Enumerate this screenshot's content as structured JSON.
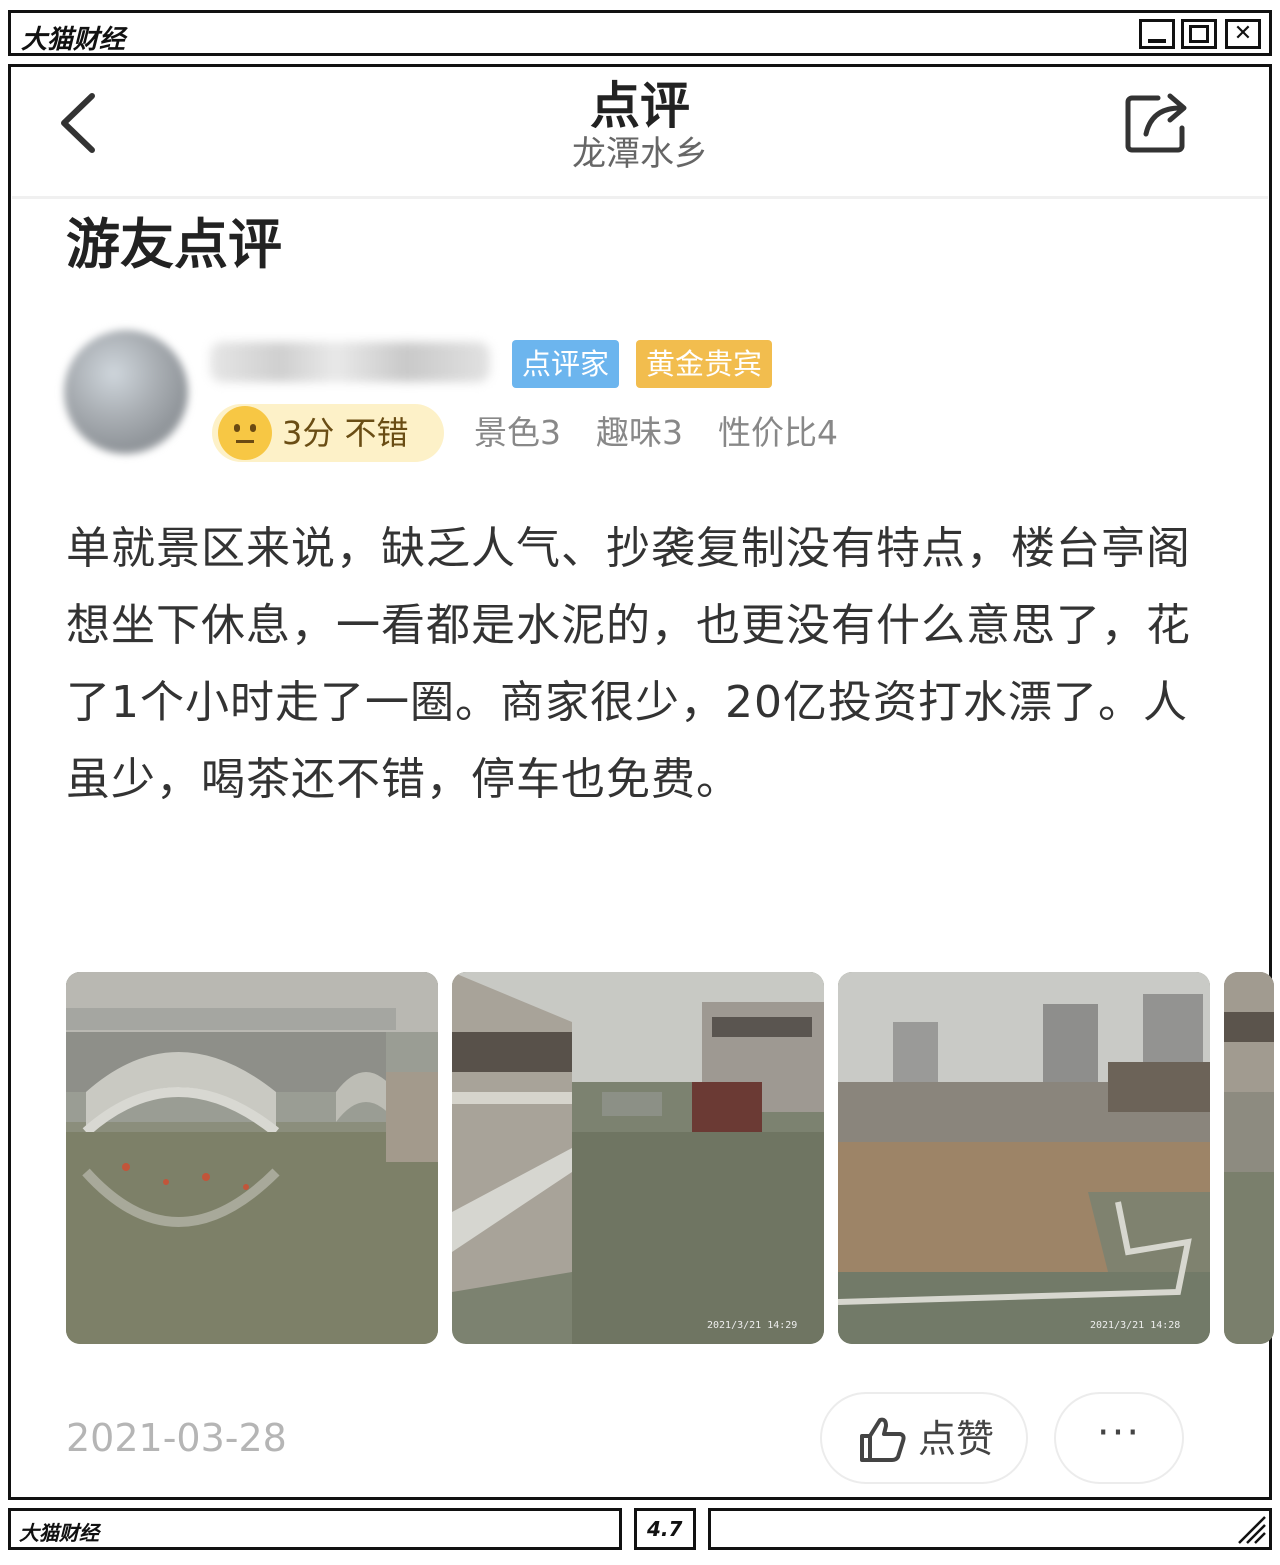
{
  "window": {
    "title": "大猫财经"
  },
  "nav": {
    "title": "点评",
    "subtitle": "龙潭水乡",
    "back_icon": "back-chevron-icon",
    "share_icon": "share-icon"
  },
  "section_title": "游友点评",
  "review": {
    "badges": [
      "点评家",
      "黄金贵宾"
    ],
    "badge_colors": [
      "#6cb5ee",
      "#f2bd4e"
    ],
    "rating": {
      "icon": "neutral-face-icon",
      "label": "3分 不错"
    },
    "sub_scores": [
      "景色3",
      "趣味3",
      "性价比4"
    ],
    "text": "单就景区来说，缺乏人气、抄袭复制没有特点，楼台亭阁想坐下休息，一看都是水泥的，也更没有什么意思了，花了1个小时走了一圈。商家很少，20亿投资打水漂了。人虽少，喝茶还不错，停车也免费。",
    "date": "2021-03-28",
    "like_label": "点赞",
    "like_icon": "thumbs-up-icon",
    "more_label": "···"
  },
  "status_bar": {
    "left": "大猫财经",
    "middle": "4.7",
    "right": ""
  }
}
